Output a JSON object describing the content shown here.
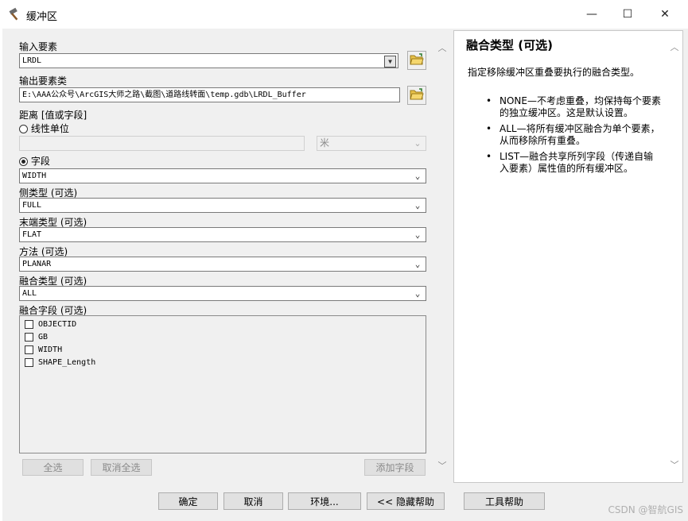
{
  "window": {
    "title": "缓冲区",
    "minimize_glyph": "—",
    "maximize_glyph": "☐",
    "close_glyph": "✕"
  },
  "form": {
    "input_features": {
      "label": "输入要素",
      "value": "LRDL"
    },
    "output_class": {
      "label": "输出要素类",
      "value": "E:\\AAA公众号\\ArcGIS大师之路\\截图\\道路线转面\\temp.gdb\\LRDL_Buffer"
    },
    "distance": {
      "label": "距离 [值或字段]",
      "linear_unit_label": "线性单位",
      "linear_value": "",
      "unit_value": "米",
      "field_label": "字段",
      "field_value": "WIDTH",
      "selected": "field"
    },
    "side_type": {
      "label": "侧类型 (可选)",
      "value": "FULL"
    },
    "end_type": {
      "label": "末端类型 (可选)",
      "value": "FLAT"
    },
    "method": {
      "label": "方法 (可选)",
      "value": "PLANAR"
    },
    "dissolve_type": {
      "label": "融合类型 (可选)",
      "value": "ALL"
    },
    "dissolve_fields": {
      "label": "融合字段 (可选)",
      "fields": [
        "OBJECTID",
        "GB",
        "WIDTH",
        "SHAPE_Length"
      ],
      "select_all": "全选",
      "unselect_all": "取消全选",
      "add_field": "添加字段"
    }
  },
  "buttons": {
    "ok": "确定",
    "cancel": "取消",
    "environments": "环境...",
    "hide_help": "<< 隐藏帮助",
    "tool_help": "工具帮助"
  },
  "help": {
    "title": "融合类型 (可选)",
    "description": "指定移除缓冲区重叠要执行的融合类型。",
    "bullets": [
      "NONE—不考虑重叠，均保持每个要素的独立缓冲区。这是默认设置。",
      "ALL—将所有缓冲区融合为单个要素，从而移除所有重叠。",
      "LIST—融合共享所列字段（传递自输入要素）属性值的所有缓冲区。"
    ]
  },
  "watermark": "CSDN @智航GIS",
  "icons": {
    "title": "hammer-icon",
    "browse": "folder-open-icon",
    "dropdown": "chevron-down-icon",
    "scroll_up": "scroll-up-arrow-icon",
    "scroll_down": "scroll-down-arrow-icon"
  }
}
